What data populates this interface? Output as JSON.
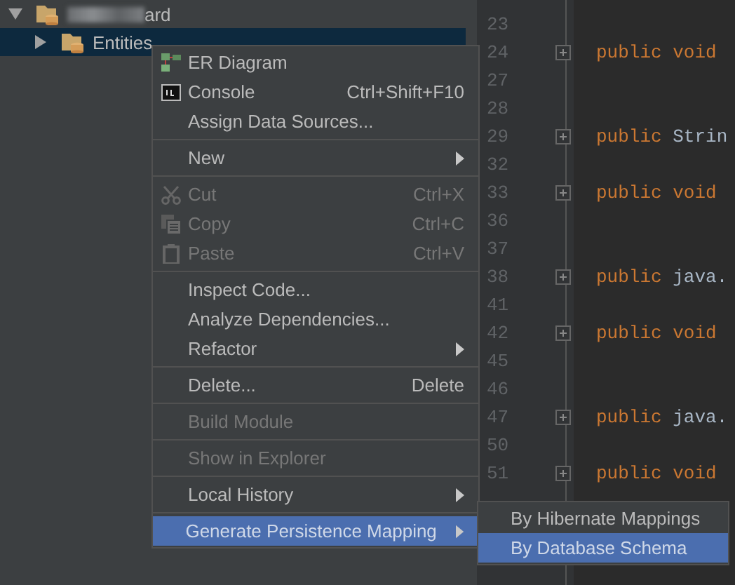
{
  "tree": [
    {
      "label": "ard",
      "expanded": true,
      "selected": false,
      "redacted": true
    },
    {
      "label": "Entities",
      "expanded": false,
      "selected": true,
      "redacted": false
    }
  ],
  "editor": {
    "lines": [
      {
        "number": "23"
      },
      {
        "number": "24",
        "fold": true,
        "code": [
          {
            "kind": "keyword",
            "text": "public void "
          }
        ]
      },
      {
        "number": "27"
      },
      {
        "number": "28"
      },
      {
        "number": "29",
        "fold": true,
        "code": [
          {
            "kind": "keyword",
            "text": "public "
          },
          {
            "kind": "plain",
            "text": "Strin"
          }
        ]
      },
      {
        "number": "32"
      },
      {
        "number": "33",
        "fold": true,
        "code": [
          {
            "kind": "keyword",
            "text": "public void "
          }
        ]
      },
      {
        "number": "36"
      },
      {
        "number": "37"
      },
      {
        "number": "38",
        "fold": true,
        "code": [
          {
            "kind": "keyword",
            "text": "public "
          },
          {
            "kind": "plain",
            "text": "java."
          }
        ]
      },
      {
        "number": "41"
      },
      {
        "number": "42",
        "fold": true,
        "code": [
          {
            "kind": "keyword",
            "text": "public void "
          }
        ]
      },
      {
        "number": "45"
      },
      {
        "number": "46"
      },
      {
        "number": "47",
        "fold": true,
        "code": [
          {
            "kind": "keyword",
            "text": "public "
          },
          {
            "kind": "plain",
            "text": "java."
          }
        ]
      },
      {
        "number": "50"
      },
      {
        "number": "51",
        "fold": true,
        "code": [
          {
            "kind": "keyword",
            "text": "public void "
          }
        ]
      }
    ]
  },
  "context_menu": {
    "items": [
      {
        "kind": "item",
        "label": "ER Diagram",
        "disabled": false,
        "submenu": false,
        "selected": false
      },
      {
        "kind": "item",
        "label": "Console",
        "shortcut": "Ctrl+Shift+F10",
        "disabled": false,
        "submenu": false,
        "selected": false
      },
      {
        "kind": "item",
        "label": "Assign Data Sources...",
        "disabled": false,
        "submenu": false,
        "selected": false
      },
      {
        "kind": "separator"
      },
      {
        "kind": "item",
        "label": "New",
        "disabled": false,
        "submenu": true,
        "selected": false
      },
      {
        "kind": "separator"
      },
      {
        "kind": "item",
        "label": "Cut",
        "shortcut": "Ctrl+X",
        "disabled": true,
        "submenu": false,
        "selected": false
      },
      {
        "kind": "item",
        "label": "Copy",
        "shortcut": "Ctrl+C",
        "disabled": true,
        "submenu": false,
        "selected": false
      },
      {
        "kind": "item",
        "label": "Paste",
        "shortcut": "Ctrl+V",
        "disabled": true,
        "submenu": false,
        "selected": false
      },
      {
        "kind": "separator"
      },
      {
        "kind": "item",
        "label": "Inspect Code...",
        "disabled": false,
        "submenu": false,
        "selected": false
      },
      {
        "kind": "item",
        "label": "Analyze Dependencies...",
        "disabled": false,
        "submenu": false,
        "selected": false
      },
      {
        "kind": "item",
        "label": "Refactor",
        "disabled": false,
        "submenu": true,
        "selected": false
      },
      {
        "kind": "separator"
      },
      {
        "kind": "item",
        "label": "Delete...",
        "shortcut": "Delete",
        "disabled": false,
        "submenu": false,
        "selected": false
      },
      {
        "kind": "separator"
      },
      {
        "kind": "item",
        "label": "Build Module",
        "disabled": true,
        "submenu": false,
        "selected": false
      },
      {
        "kind": "separator"
      },
      {
        "kind": "item",
        "label": "Show in Explorer",
        "disabled": true,
        "submenu": false,
        "selected": false
      },
      {
        "kind": "separator"
      },
      {
        "kind": "item",
        "label": "Local History",
        "disabled": false,
        "submenu": true,
        "selected": false
      },
      {
        "kind": "separator"
      },
      {
        "kind": "item",
        "label": "Generate Persistence Mapping",
        "disabled": false,
        "submenu": true,
        "selected": true
      }
    ]
  },
  "submenu": {
    "items": [
      {
        "label": "By Hibernate Mappings",
        "selected": false
      },
      {
        "label": "By Database Schema",
        "selected": true
      }
    ]
  }
}
